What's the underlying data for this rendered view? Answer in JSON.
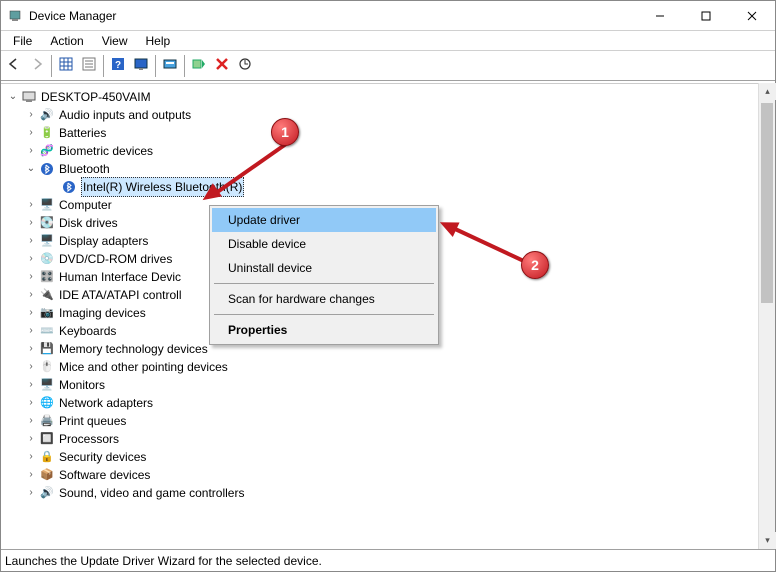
{
  "window": {
    "title": "Device Manager"
  },
  "menu": {
    "items": [
      "File",
      "Action",
      "View",
      "Help"
    ]
  },
  "toolbar": {
    "buttons": [
      {
        "name": "back-icon"
      },
      {
        "name": "forward-icon",
        "disabled": true
      },
      {
        "sep": true
      },
      {
        "name": "show-hidden-icon"
      },
      {
        "name": "properties-icon"
      },
      {
        "sep": true
      },
      {
        "name": "help-icon"
      },
      {
        "name": "view-icon"
      },
      {
        "sep": true
      },
      {
        "name": "update-driver-icon"
      },
      {
        "sep": true
      },
      {
        "name": "enable-device-icon"
      },
      {
        "name": "uninstall-icon"
      },
      {
        "name": "scan-hardware-icon"
      }
    ]
  },
  "tree": {
    "root": {
      "label": "DESKTOP-450VAIM"
    },
    "bluetooth_child": {
      "label": "Intel(R) Wireless Bluetooth(R)"
    },
    "categories": [
      {
        "label": "Audio inputs and outputs"
      },
      {
        "label": "Batteries"
      },
      {
        "label": "Biometric devices"
      },
      {
        "label": "Bluetooth",
        "expanded": true
      },
      {
        "label": "Computer"
      },
      {
        "label": "Disk drives"
      },
      {
        "label": "Display adapters"
      },
      {
        "label": "DVD/CD-ROM drives"
      },
      {
        "label": "Human Interface Devic"
      },
      {
        "label": "IDE ATA/ATAPI controll"
      },
      {
        "label": "Imaging devices"
      },
      {
        "label": "Keyboards"
      },
      {
        "label": "Memory technology devices"
      },
      {
        "label": "Mice and other pointing devices"
      },
      {
        "label": "Monitors"
      },
      {
        "label": "Network adapters"
      },
      {
        "label": "Print queues"
      },
      {
        "label": "Processors"
      },
      {
        "label": "Security devices"
      },
      {
        "label": "Software devices"
      },
      {
        "label": "Sound, video and game controllers"
      }
    ]
  },
  "context_menu": {
    "items": [
      {
        "label": "Update driver",
        "highlight": true
      },
      {
        "label": "Disable device"
      },
      {
        "label": "Uninstall device"
      },
      {
        "sep": true
      },
      {
        "label": "Scan for hardware changes"
      },
      {
        "sep": true
      },
      {
        "label": "Properties",
        "bold": true
      }
    ],
    "update": "Update driver",
    "disable": "Disable device",
    "uninstall": "Uninstall device",
    "scan": "Scan for hardware changes",
    "properties": "Properties"
  },
  "statusbar": {
    "text": "Launches the Update Driver Wizard for the selected device."
  },
  "annotations": {
    "m1": "1",
    "m2": "2"
  }
}
